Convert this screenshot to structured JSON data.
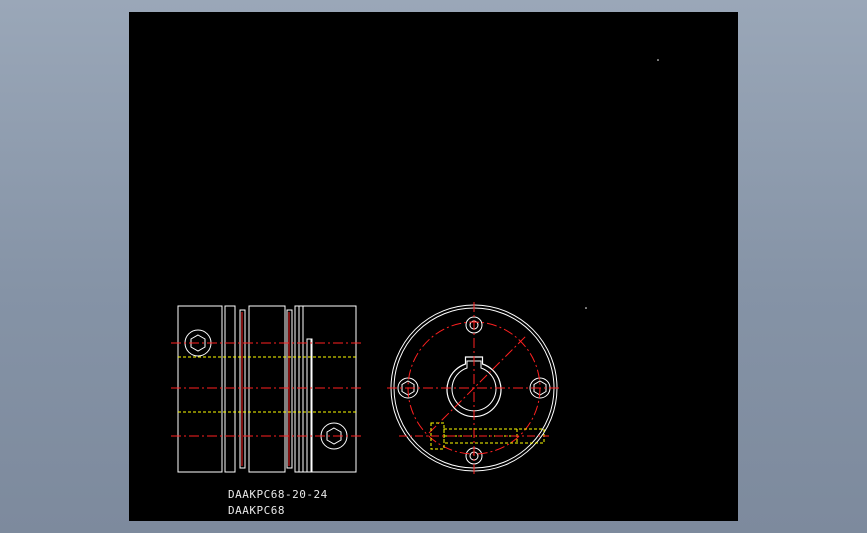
{
  "drawing": {
    "labels": [
      "DAAKPC68-20-24",
      "DAAKPC68"
    ],
    "colors": {
      "background": "#000000",
      "outline": "#ffffff",
      "centerline": "#ff2020",
      "hidden": "#ffff00"
    }
  }
}
